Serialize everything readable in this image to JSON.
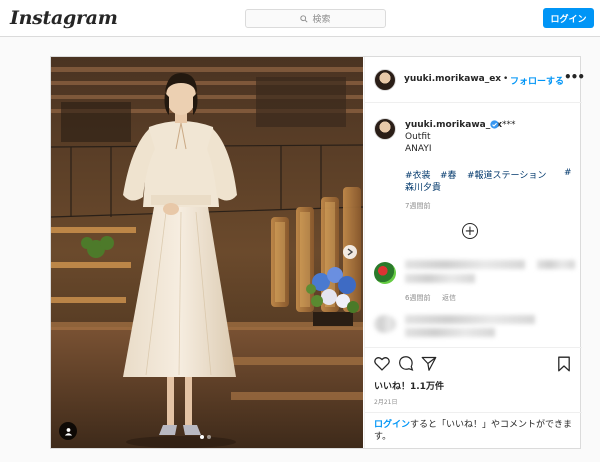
{
  "nav": {
    "logo": "Instagram",
    "search_placeholder": "検索",
    "login_label": "ログイン"
  },
  "post": {
    "username": "yuuki.morikawa_ex",
    "separator": "•",
    "follow_label": "フォローする",
    "more_label": "•••",
    "caption": {
      "username": "yuuki.morikawa_ex",
      "suffix": "***",
      "line1": "Outfit",
      "line2": "ANAYI",
      "hashtags": [
        "#衣装",
        "#春",
        "#報道ステーション",
        "#",
        "森川夕貴"
      ],
      "time": "7週間前"
    },
    "comment": {
      "time": "6週間前",
      "reply_label": "返信"
    },
    "likes": "いいね！1.1万件",
    "date": "2月21日",
    "login_prompt": {
      "link": "ログイン",
      "rest": "すると「いいね！」やコメントができます。"
    }
  },
  "colors": {
    "accent": "#0095f6",
    "link": "#00376b",
    "border": "#dbdbdb",
    "muted": "#8e8e8e"
  },
  "icons": [
    "search-icon",
    "more-icon",
    "verified-icon",
    "add-comment-icon",
    "heart-icon",
    "comment-icon",
    "share-icon",
    "save-icon",
    "user-tag-icon",
    "next-arrow-icon"
  ]
}
